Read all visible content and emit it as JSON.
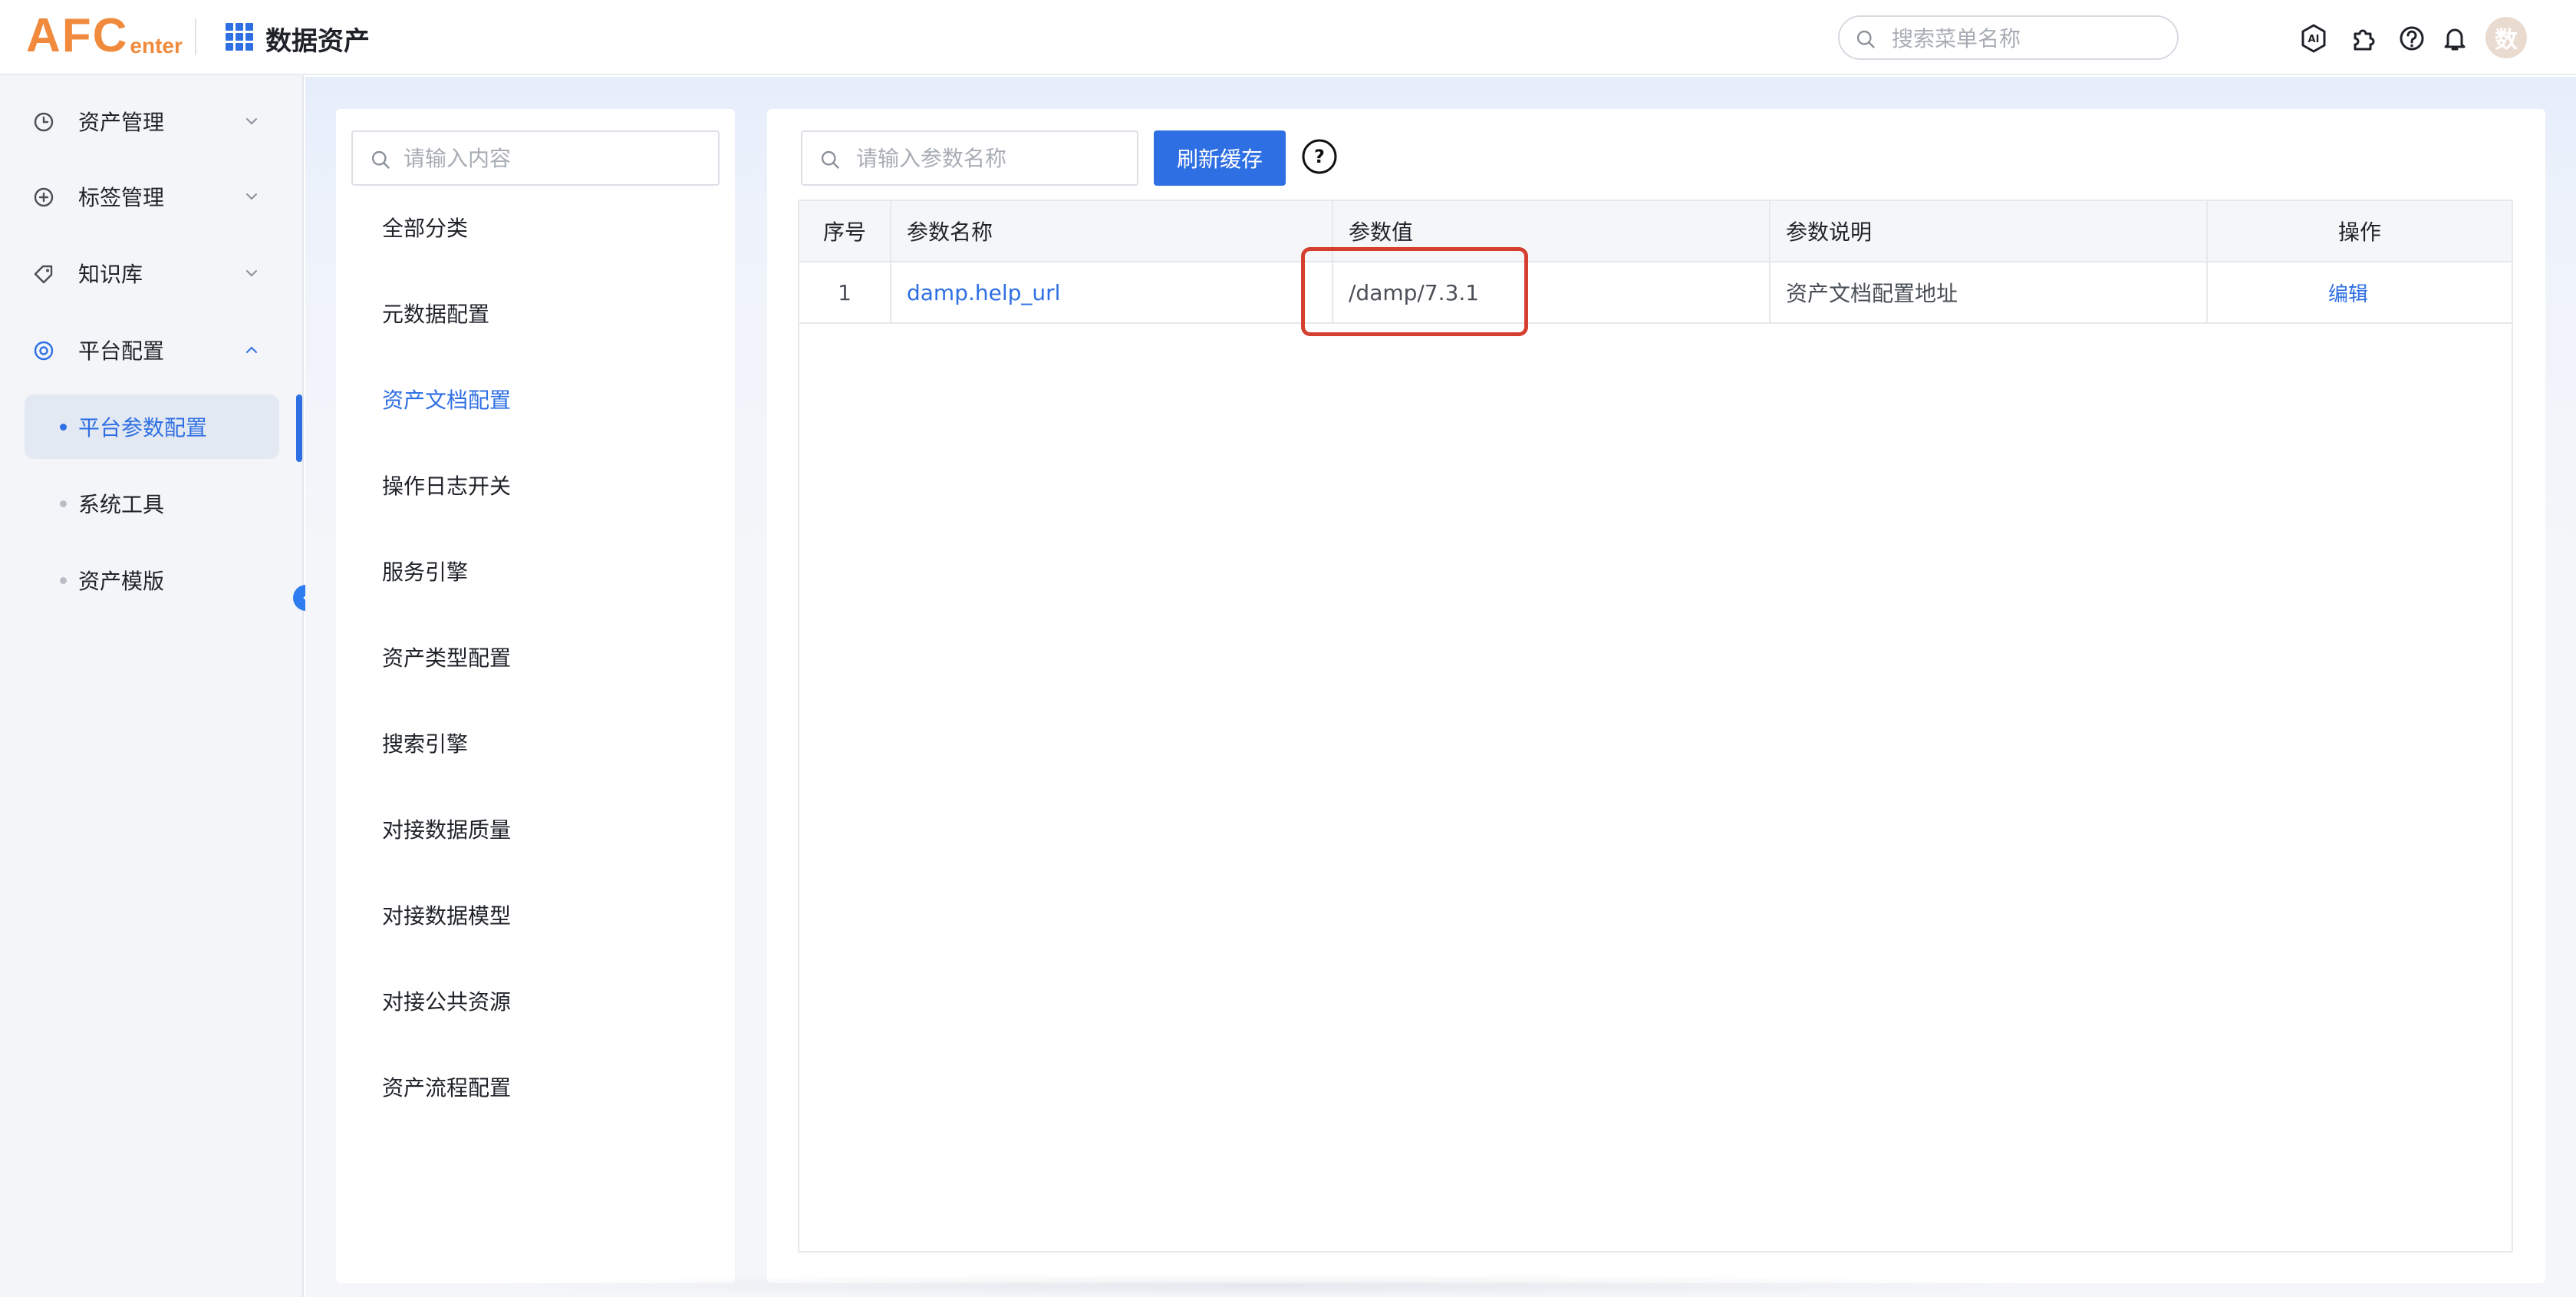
{
  "header": {
    "logo_main": "AFC",
    "logo_sub": "enter",
    "app_title": "数据资产",
    "menu_search_placeholder": "搜索菜单名称",
    "avatar_text": "数"
  },
  "sidebar": {
    "items": [
      {
        "label": "资产管理"
      },
      {
        "label": "标签管理"
      },
      {
        "label": "知识库"
      },
      {
        "label": "平台配置"
      }
    ],
    "sub_items": [
      {
        "label": "平台参数配置",
        "active": true
      },
      {
        "label": "系统工具"
      },
      {
        "label": "资产模版"
      }
    ]
  },
  "category_panel": {
    "search_placeholder": "请输入内容",
    "items": [
      "全部分类",
      "元数据配置",
      "资产文档配置",
      "操作日志开关",
      "服务引擎",
      "资产类型配置",
      "搜索引擎",
      "对接数据质量",
      "对接数据模型",
      "对接公共资源",
      "资产流程配置"
    ],
    "active_item": "资产文档配置"
  },
  "main_panel": {
    "search_placeholder": "请输入参数名称",
    "refresh_label": "刷新缓存",
    "help_symbol": "?",
    "table": {
      "headers": [
        "序号",
        "参数名称",
        "参数值",
        "参数说明",
        "操作"
      ],
      "rows": [
        {
          "index": "1",
          "name": "damp.help_url",
          "value": "/damp/7.3.1",
          "description": "资产文档配置地址",
          "action": "编辑"
        }
      ]
    }
  },
  "colors": {
    "primary": "#2f6fe4",
    "logo": "#f08a3c",
    "highlight": "#d43f2f"
  }
}
